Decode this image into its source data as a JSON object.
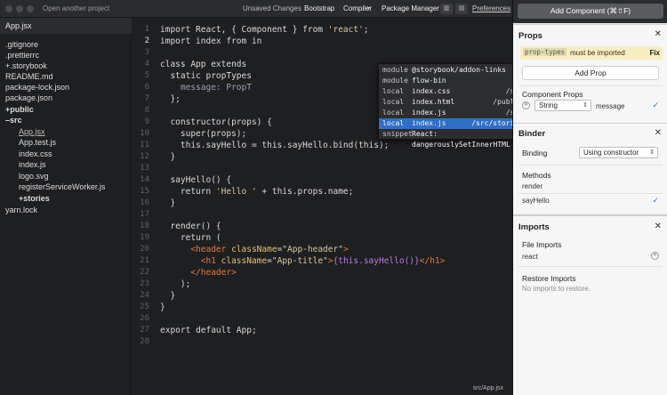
{
  "topbar": {
    "open_project": "Open another project",
    "unsaved": "Unsaved Changes",
    "bootstrap": "Bootstrap",
    "compiler": "Compiler",
    "package_manager": "Package Manager",
    "preferences": "Preferences"
  },
  "sidebar": {
    "tab": "App.jsx",
    "items": [
      {
        "label": ".gitignore"
      },
      {
        "label": ".prettierrc"
      },
      {
        "label": "+.storybook"
      },
      {
        "label": "README.md"
      },
      {
        "label": "package-lock.json"
      },
      {
        "label": "package.json"
      },
      {
        "label": "+public"
      },
      {
        "label": "–src"
      },
      {
        "label": "App.jsx"
      },
      {
        "label": "App.test.js"
      },
      {
        "label": "index.css"
      },
      {
        "label": "index.js"
      },
      {
        "label": "logo.svg"
      },
      {
        "label": "registerServiceWorker.js"
      },
      {
        "label": "+stories"
      },
      {
        "label": "yarn.lock"
      }
    ]
  },
  "editor": {
    "line_numbers": [
      "1",
      "2",
      "3",
      "4",
      "5",
      "6",
      "7",
      "8",
      "9",
      "10",
      "11",
      "12",
      "13",
      "14",
      "15",
      "16",
      "17",
      "18",
      "19",
      "20",
      "21",
      "22",
      "23",
      "24",
      "25",
      "26",
      "27",
      "28"
    ],
    "lines": {
      "l1_a": "import React, { Component } from ",
      "l1_b": "'react'",
      "l1_c": ";",
      "l2": "import index from in",
      "l4": "class App extends ",
      "l5": "  static propTypes",
      "l6": "    message: PropT",
      "l7": "  };",
      "l9": "  constructor(props) {",
      "l10": "    super(props);",
      "l11": "    this.sayHello = this.sayHello.bind(this);",
      "l12": "  }",
      "l14": "  sayHello() {",
      "l15_a": "    return ",
      "l15_b": "'Hello '",
      "l15_c": " + this.props.name;",
      "l16": "  }",
      "l18": "  render() {",
      "l19": "    return (",
      "l20_a": "      <header ",
      "l20_b": "className",
      "l20_c": "=",
      "l20_d": "\"App-header\"",
      "l20_e": ">",
      "l21_a": "        <h1 ",
      "l21_b": "className",
      "l21_c": "=",
      "l21_d": "\"App-title\"",
      "l21_e": ">",
      "l21_f": "{this.sayHello()}",
      "l21_g": "</h1>",
      "l22": "      </header>",
      "l23": "    );",
      "l24": "  }",
      "l25": "}",
      "l27": "export default App;"
    },
    "autocomplete": [
      {
        "kind": "module",
        "label": "@storybook/addon-links",
        "detail": ""
      },
      {
        "kind": "module",
        "label": "flow-bin",
        "detail": ""
      },
      {
        "kind": "local",
        "label": "index.css",
        "detail": "/src"
      },
      {
        "kind": "local",
        "label": "index.html",
        "detail": "/public"
      },
      {
        "kind": "local",
        "label": "index.js",
        "detail": "/src"
      },
      {
        "kind": "local",
        "label": "index.js",
        "detail": "/src/stories"
      },
      {
        "kind": "snippet",
        "label": "React: dangerouslySetInnerHTML",
        "detail": ""
      }
    ]
  },
  "status": {
    "path": "src/App.jsx"
  },
  "panel": {
    "add_component": "Add Component (⌘⇧F)",
    "props": {
      "title": "Props",
      "warning_code": "prop-types",
      "warning_text": "must be imported",
      "fix": "Fix",
      "add_prop": "Add Prop",
      "component_props_label": "Component Props",
      "prop_type": "String",
      "prop_name": "message"
    },
    "binder": {
      "title": "Binder",
      "binding_label": "Binding",
      "binding_value": "Using constructor",
      "methods_label": "Methods",
      "methods": [
        "render",
        "sayHello"
      ]
    },
    "imports": {
      "title": "Imports",
      "file_imports_label": "File Imports",
      "file_import": "react",
      "restore_label": "Restore Imports",
      "restore_text": "No imports to restore."
    }
  }
}
